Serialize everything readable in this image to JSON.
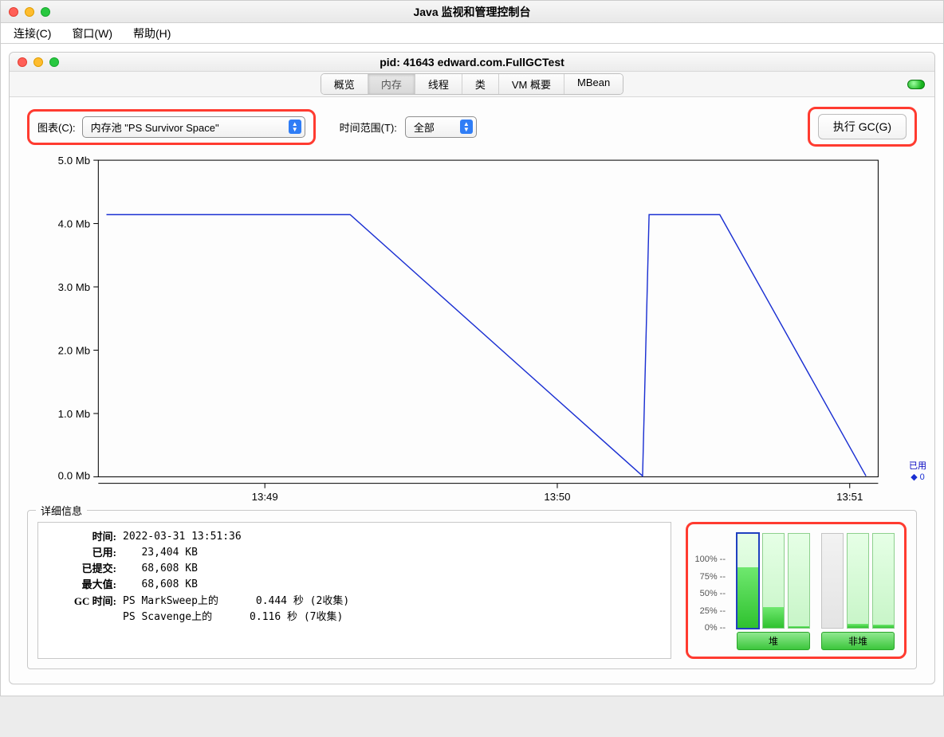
{
  "outer": {
    "title": "Java 监视和管理控制台"
  },
  "menubar": {
    "items": [
      "连接(C)",
      "窗口(W)",
      "帮助(H)"
    ]
  },
  "inner": {
    "title": "pid: 41643 edward.com.FullGCTest"
  },
  "tabs": {
    "items": [
      "概览",
      "内存",
      "线程",
      "类",
      "VM 概要",
      "MBean"
    ],
    "active_index": 1
  },
  "filter": {
    "chart_label": "图表(C):",
    "chart_value": "内存池 \"PS Survivor Space\"",
    "time_label": "时间范围(T):",
    "time_value": "全部",
    "gc_button": "执行 GC(G)"
  },
  "chart_data": {
    "type": "line",
    "xlabel": "",
    "ylabel": "",
    "ylim": [
      0,
      5.0
    ],
    "y_ticks": [
      "0.0 Mb",
      "1.0 Mb",
      "2.0 Mb",
      "3.0 Mb",
      "4.0 Mb",
      "5.0 Mb"
    ],
    "x_ticks": [
      "13:49",
      "13:50",
      "13:51"
    ],
    "series": [
      {
        "name": "已用",
        "color": "#1a2fd2",
        "points": [
          {
            "x": "13:48:30",
            "y": 4.15
          },
          {
            "x": "13:49:15",
            "y": 4.15
          },
          {
            "x": "13:50:20",
            "y": 0.0
          },
          {
            "x": "13:50:22",
            "y": 4.15
          },
          {
            "x": "13:50:36",
            "y": 4.15
          },
          {
            "x": "13:51:03",
            "y": 0.0
          }
        ]
      }
    ],
    "legend": {
      "used_label": "已用",
      "used_value": "0"
    }
  },
  "details": {
    "legend": "详细信息",
    "rows": {
      "time_label": "时间:",
      "time_val": "2022-03-31 13:51:36",
      "used_label": "已用:",
      "used_val": "   23,404 KB",
      "committed_label": "已提交:",
      "committed_val": "   68,608 KB",
      "max_label": "最大值:",
      "max_val": "   68,608 KB",
      "gc_label": "GC 时间:",
      "gc_val1": "PS MarkSweep上的      0.444 秒 (2收集)",
      "gc_val2": "PS Scavenge上的      0.116 秒 (7收集)"
    }
  },
  "bars": {
    "scale": [
      "100% --",
      "75% --",
      "50% --",
      "25% --",
      "0% --"
    ],
    "heap": {
      "label": "堆",
      "bars": [
        {
          "fill_pct": 64,
          "selected": true
        },
        {
          "fill_pct": 22,
          "selected": false
        },
        {
          "fill_pct": 2,
          "selected": false
        }
      ]
    },
    "nonheap": {
      "label": "非堆",
      "bars": [
        {
          "fill_pct": 0,
          "gray": true
        },
        {
          "fill_pct": 4
        },
        {
          "fill_pct": 3
        }
      ]
    }
  }
}
